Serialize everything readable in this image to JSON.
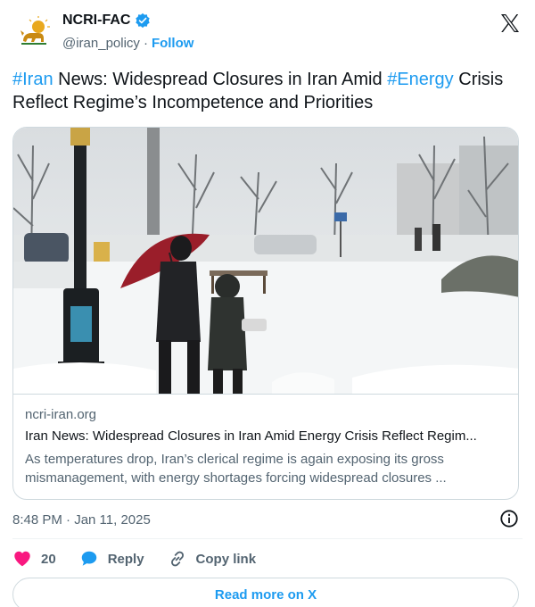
{
  "author": {
    "name": "NCRI-FAC",
    "handle": "@iran_policy",
    "separator": "·",
    "follow_label": "Follow"
  },
  "tweet": {
    "segments": [
      {
        "text": "#Iran",
        "hashtag": true
      },
      {
        "text": " News: Widespread Closures in Iran Amid ",
        "hashtag": false
      },
      {
        "text": "#Energy",
        "hashtag": true
      },
      {
        "text": " Crisis Reflect Regime’s Incompetence and Priorities",
        "hashtag": false
      }
    ]
  },
  "card": {
    "domain": "ncri-iran.org",
    "title": "Iran News: Widespread Closures in Iran Amid Energy Crisis Reflect Regim...",
    "description": "As temperatures drop, Iran’s clerical regime is again exposing its gross mismanagement, with energy shortages forcing widespread closures ..."
  },
  "meta": {
    "timestamp": "8:48 PM · Jan 11, 2025"
  },
  "actions": {
    "like_count": "20",
    "reply_label": "Reply",
    "copy_link_label": "Copy link"
  },
  "footer": {
    "read_more_label": "Read more on X"
  },
  "colors": {
    "accent": "#1d9bf0",
    "like": "#f91880",
    "text": "#0f1419",
    "secondary": "#536471",
    "border": "#cfd9de"
  },
  "icons": {
    "avatar": "lion-and-sun-emblem",
    "verified": "verified-badge-icon",
    "brand": "x-logo-icon",
    "info": "info-icon",
    "like": "heart-icon",
    "reply": "speech-bubble-icon",
    "copy": "link-icon"
  }
}
